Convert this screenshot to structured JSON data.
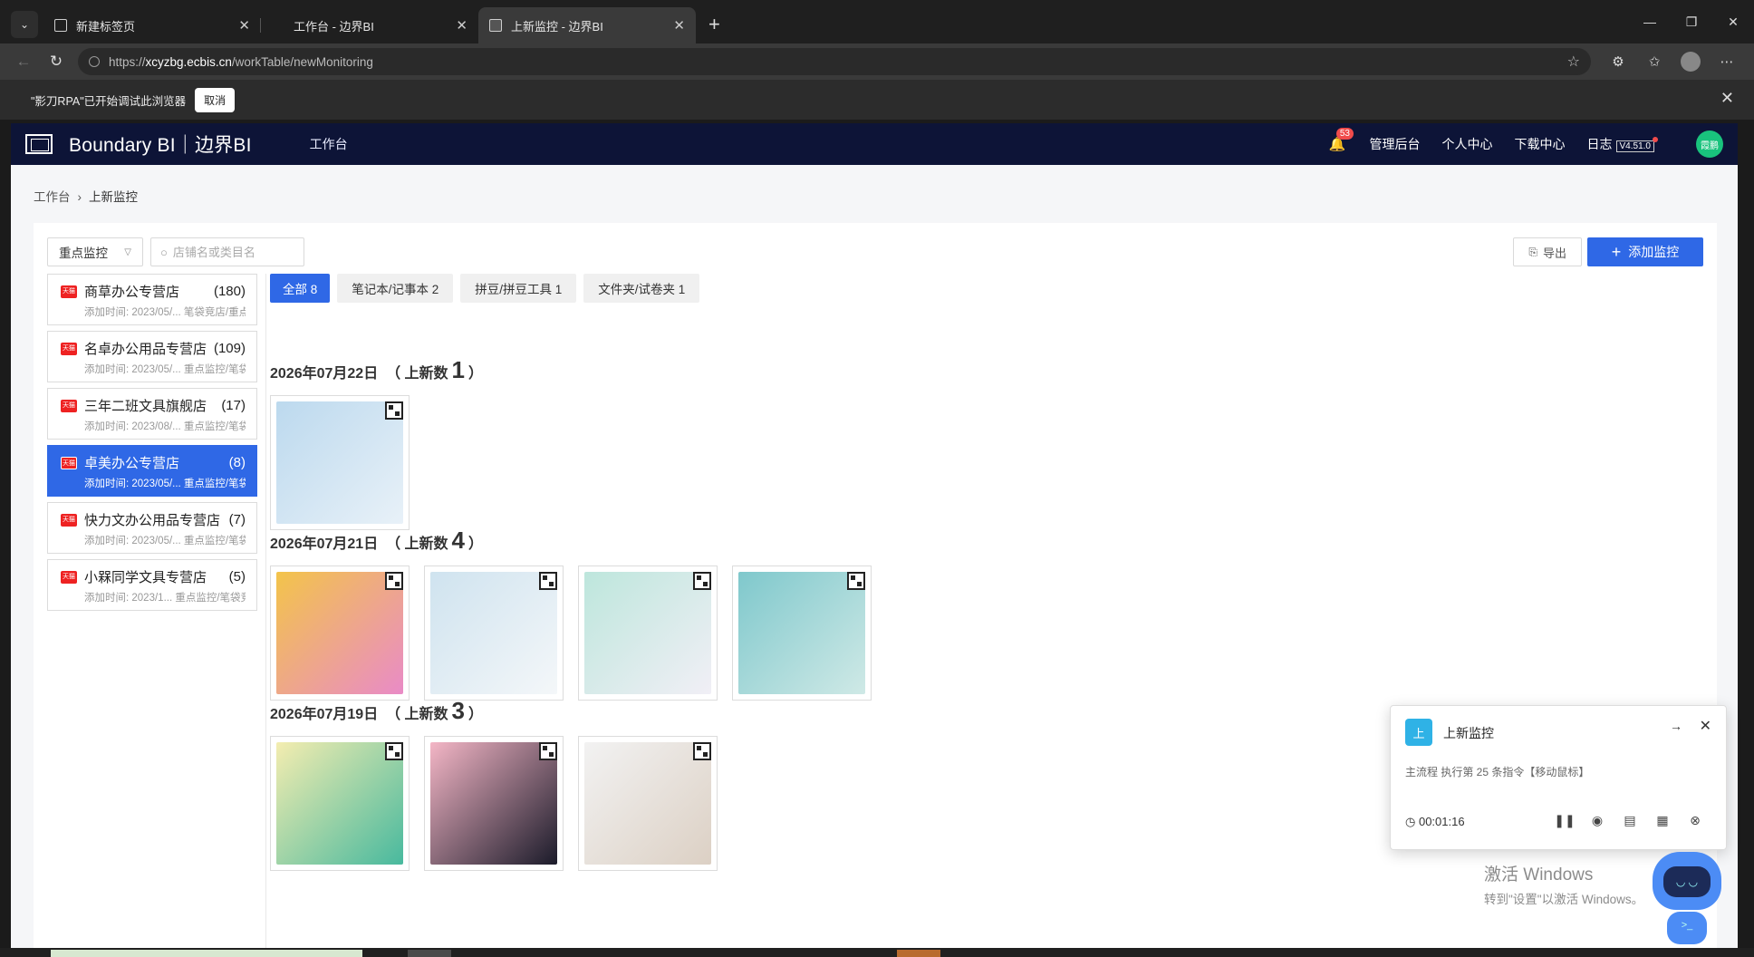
{
  "browser": {
    "tabs": [
      {
        "title": "新建标签页",
        "active": false
      },
      {
        "title": "工作台 - 边界BI",
        "active": false
      },
      {
        "title": "上新监控 - 边界BI",
        "active": true
      }
    ],
    "url_scheme": "https://",
    "url_host": "xcyzbg.ecbis.cn",
    "url_path": "/workTable/newMonitoring",
    "infobar_text": "\"影刀RPA\"已开始调试此浏览器",
    "infobar_cancel": "取消"
  },
  "app": {
    "brand": "Boundary BI｜边界BI",
    "nav_work": "工作台",
    "bell_badge": "53",
    "nav_admin": "管理后台",
    "nav_personal": "个人中心",
    "nav_download": "下载中心",
    "nav_log": "日志",
    "version": "V4.51.0",
    "user_initials": "霞鹏"
  },
  "breadcrumb": {
    "root": "工作台",
    "current": "上新监控"
  },
  "filters": {
    "select_value": "重点监控",
    "search_placeholder": "店铺名或类目名"
  },
  "actions": {
    "export": "导出",
    "add": "添加监控"
  },
  "shops": [
    {
      "name": "商草办公专营店",
      "count": "(180)",
      "meta": "添加时间: 2023/05/... 笔袋竞店/重点监控",
      "active": false
    },
    {
      "name": "名卓办公用品专营店",
      "count": "(109)",
      "meta": "添加时间: 2023/05/... 重点监控/笔袋竞店",
      "active": false
    },
    {
      "name": "三年二班文具旗舰店",
      "count": "(17)",
      "meta": "添加时间: 2023/08/... 重点监控/笔袋竞店",
      "active": false
    },
    {
      "name": "卓美办公专营店",
      "count": "(8)",
      "meta": "添加时间: 2023/05/... 重点监控/笔袋竞店",
      "active": true
    },
    {
      "name": "快力文办公用品专营店",
      "count": "(7)",
      "meta": "添加时间: 2023/05/... 重点监控/笔袋竞店",
      "active": false
    },
    {
      "name": "小槑同学文具专营店",
      "count": "(5)",
      "meta": "添加时间: 2023/1... 重点监控/笔袋竞...",
      "active": false
    }
  ],
  "shop_badge": "天猫",
  "categories": [
    {
      "label": "全部 8",
      "active": true
    },
    {
      "label": "笔记本/记事本 2",
      "active": false
    },
    {
      "label": "拼豆/拼豆工具 1",
      "active": false
    },
    {
      "label": "文件夹/试卷夹 1",
      "active": false
    }
  ],
  "days": [
    {
      "date": "2026年07月22日",
      "prefix": "（ 上新数",
      "count": "1",
      "suffix": "）",
      "thumbs": [
        "#b9d6ec",
        "#dfeaf3"
      ],
      "n": 1
    },
    {
      "date": "2026年07月21日",
      "prefix": "（ 上新数",
      "count": "4",
      "suffix": "）",
      "n": 4
    },
    {
      "date": "2026年07月19日",
      "prefix": "（ 上新数",
      "count": "3",
      "suffix": "）",
      "n": 3
    }
  ],
  "rpa": {
    "icon": "上",
    "title": "上新监控",
    "status": "主流程 执行第 25 条指令【移动鼠标】",
    "timer": "00:01:16"
  },
  "activate": {
    "line1": "激活 Windows",
    "line2": "转到\"设置\"以激活 Windows。"
  }
}
